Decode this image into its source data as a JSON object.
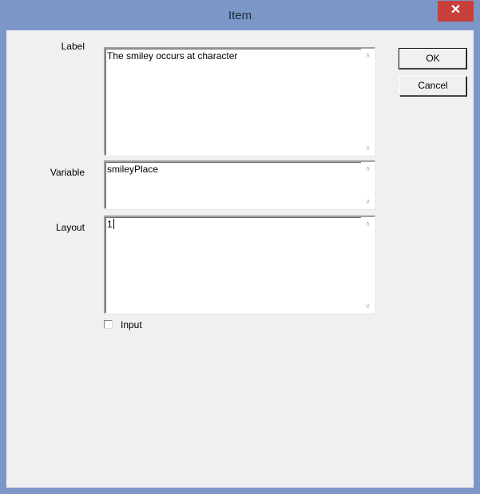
{
  "window": {
    "title": "Item",
    "close_glyph": "✕"
  },
  "form": {
    "label": {
      "caption": "Label",
      "value": "The smiley occurs at character"
    },
    "variable": {
      "caption": "Variable",
      "value": "smileyPlace"
    },
    "layout": {
      "caption": "Layout",
      "value": "1"
    },
    "input_checkbox": {
      "label": "Input",
      "checked": false
    }
  },
  "buttons": {
    "ok": "OK",
    "cancel": "Cancel"
  },
  "scroll": {
    "up_glyph": "∧",
    "down_glyph": "∨"
  },
  "colors": {
    "titlebar": "#7b96c7",
    "close": "#c7403a",
    "client": "#f0f0f0"
  }
}
